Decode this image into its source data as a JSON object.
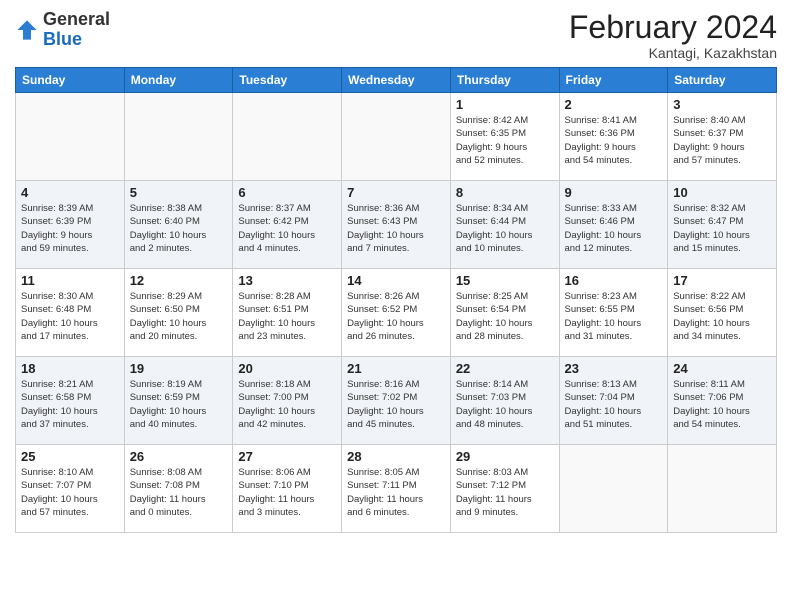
{
  "header": {
    "logo_general": "General",
    "logo_blue": "Blue",
    "month_title": "February 2024",
    "location": "Kantagi, Kazakhstan"
  },
  "days_of_week": [
    "Sunday",
    "Monday",
    "Tuesday",
    "Wednesday",
    "Thursday",
    "Friday",
    "Saturday"
  ],
  "weeks": [
    {
      "days": [
        {
          "num": "",
          "info": ""
        },
        {
          "num": "",
          "info": ""
        },
        {
          "num": "",
          "info": ""
        },
        {
          "num": "",
          "info": ""
        },
        {
          "num": "1",
          "info": "Sunrise: 8:42 AM\nSunset: 6:35 PM\nDaylight: 9 hours\nand 52 minutes."
        },
        {
          "num": "2",
          "info": "Sunrise: 8:41 AM\nSunset: 6:36 PM\nDaylight: 9 hours\nand 54 minutes."
        },
        {
          "num": "3",
          "info": "Sunrise: 8:40 AM\nSunset: 6:37 PM\nDaylight: 9 hours\nand 57 minutes."
        }
      ]
    },
    {
      "days": [
        {
          "num": "4",
          "info": "Sunrise: 8:39 AM\nSunset: 6:39 PM\nDaylight: 9 hours\nand 59 minutes."
        },
        {
          "num": "5",
          "info": "Sunrise: 8:38 AM\nSunset: 6:40 PM\nDaylight: 10 hours\nand 2 minutes."
        },
        {
          "num": "6",
          "info": "Sunrise: 8:37 AM\nSunset: 6:42 PM\nDaylight: 10 hours\nand 4 minutes."
        },
        {
          "num": "7",
          "info": "Sunrise: 8:36 AM\nSunset: 6:43 PM\nDaylight: 10 hours\nand 7 minutes."
        },
        {
          "num": "8",
          "info": "Sunrise: 8:34 AM\nSunset: 6:44 PM\nDaylight: 10 hours\nand 10 minutes."
        },
        {
          "num": "9",
          "info": "Sunrise: 8:33 AM\nSunset: 6:46 PM\nDaylight: 10 hours\nand 12 minutes."
        },
        {
          "num": "10",
          "info": "Sunrise: 8:32 AM\nSunset: 6:47 PM\nDaylight: 10 hours\nand 15 minutes."
        }
      ]
    },
    {
      "days": [
        {
          "num": "11",
          "info": "Sunrise: 8:30 AM\nSunset: 6:48 PM\nDaylight: 10 hours\nand 17 minutes."
        },
        {
          "num": "12",
          "info": "Sunrise: 8:29 AM\nSunset: 6:50 PM\nDaylight: 10 hours\nand 20 minutes."
        },
        {
          "num": "13",
          "info": "Sunrise: 8:28 AM\nSunset: 6:51 PM\nDaylight: 10 hours\nand 23 minutes."
        },
        {
          "num": "14",
          "info": "Sunrise: 8:26 AM\nSunset: 6:52 PM\nDaylight: 10 hours\nand 26 minutes."
        },
        {
          "num": "15",
          "info": "Sunrise: 8:25 AM\nSunset: 6:54 PM\nDaylight: 10 hours\nand 28 minutes."
        },
        {
          "num": "16",
          "info": "Sunrise: 8:23 AM\nSunset: 6:55 PM\nDaylight: 10 hours\nand 31 minutes."
        },
        {
          "num": "17",
          "info": "Sunrise: 8:22 AM\nSunset: 6:56 PM\nDaylight: 10 hours\nand 34 minutes."
        }
      ]
    },
    {
      "days": [
        {
          "num": "18",
          "info": "Sunrise: 8:21 AM\nSunset: 6:58 PM\nDaylight: 10 hours\nand 37 minutes."
        },
        {
          "num": "19",
          "info": "Sunrise: 8:19 AM\nSunset: 6:59 PM\nDaylight: 10 hours\nand 40 minutes."
        },
        {
          "num": "20",
          "info": "Sunrise: 8:18 AM\nSunset: 7:00 PM\nDaylight: 10 hours\nand 42 minutes."
        },
        {
          "num": "21",
          "info": "Sunrise: 8:16 AM\nSunset: 7:02 PM\nDaylight: 10 hours\nand 45 minutes."
        },
        {
          "num": "22",
          "info": "Sunrise: 8:14 AM\nSunset: 7:03 PM\nDaylight: 10 hours\nand 48 minutes."
        },
        {
          "num": "23",
          "info": "Sunrise: 8:13 AM\nSunset: 7:04 PM\nDaylight: 10 hours\nand 51 minutes."
        },
        {
          "num": "24",
          "info": "Sunrise: 8:11 AM\nSunset: 7:06 PM\nDaylight: 10 hours\nand 54 minutes."
        }
      ]
    },
    {
      "days": [
        {
          "num": "25",
          "info": "Sunrise: 8:10 AM\nSunset: 7:07 PM\nDaylight: 10 hours\nand 57 minutes."
        },
        {
          "num": "26",
          "info": "Sunrise: 8:08 AM\nSunset: 7:08 PM\nDaylight: 11 hours\nand 0 minutes."
        },
        {
          "num": "27",
          "info": "Sunrise: 8:06 AM\nSunset: 7:10 PM\nDaylight: 11 hours\nand 3 minutes."
        },
        {
          "num": "28",
          "info": "Sunrise: 8:05 AM\nSunset: 7:11 PM\nDaylight: 11 hours\nand 6 minutes."
        },
        {
          "num": "29",
          "info": "Sunrise: 8:03 AM\nSunset: 7:12 PM\nDaylight: 11 hours\nand 9 minutes."
        },
        {
          "num": "",
          "info": ""
        },
        {
          "num": "",
          "info": ""
        }
      ]
    }
  ]
}
